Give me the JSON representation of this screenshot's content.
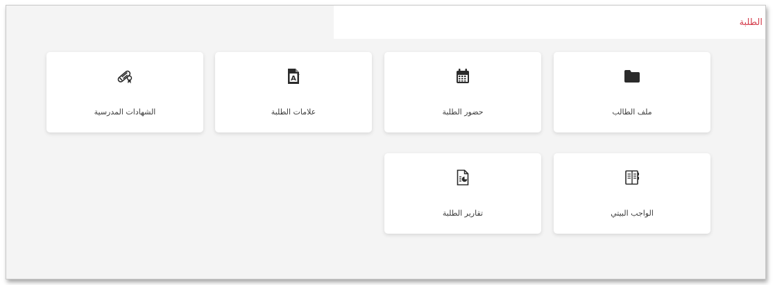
{
  "header": {
    "title": "الطلبة",
    "title_color": "#d43b4a"
  },
  "cards": [
    {
      "label": "ملف الطالب",
      "icon": "folder-icon"
    },
    {
      "label": "حضور الطلبة",
      "icon": "calendar-icon"
    },
    {
      "label": "علامات الطلبة",
      "icon": "grade-document-icon"
    },
    {
      "label": "الشهادات المدرسية",
      "icon": "diploma-icon"
    },
    {
      "label": "الواجب البيتي",
      "icon": "notebook-icon"
    },
    {
      "label": "تقارير الطلبة",
      "icon": "report-document-icon"
    }
  ]
}
